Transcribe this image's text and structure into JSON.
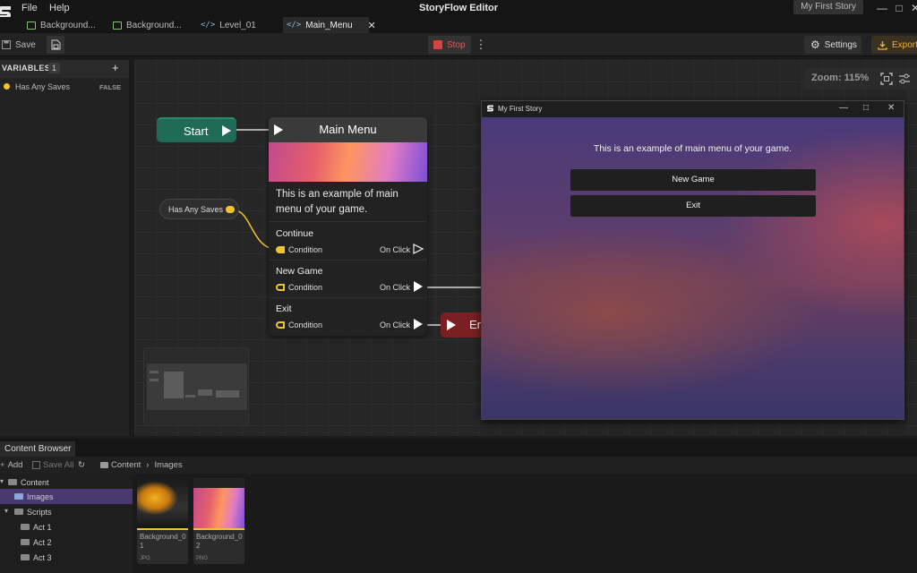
{
  "titlebar": {
    "menu": [
      "File",
      "Help"
    ],
    "app_title": "StoryFlow Editor",
    "project_name": "My First Story",
    "controls": {
      "minimize": "—",
      "maximize": "□",
      "close": "✕"
    }
  },
  "tabs": [
    {
      "label": "Background...",
      "icon": "image-icon"
    },
    {
      "label": "Background...",
      "icon": "image-icon"
    },
    {
      "label": "Level_01",
      "icon": "code-icon"
    },
    {
      "label": "Main_Menu",
      "icon": "code-icon",
      "active": true
    }
  ],
  "toolbar": {
    "save_label": "Save",
    "stop_label": "Stop",
    "settings_label": "Settings",
    "export_label": "Export"
  },
  "variables": {
    "title": "VARIABLES",
    "count": "1",
    "items": [
      {
        "name": "Has Any Saves",
        "value": "FALSE",
        "color": "#f0c430"
      }
    ]
  },
  "canvas": {
    "zoom_label": "Zoom: 115%",
    "start_node": "Start",
    "var_node": "Has Any Saves",
    "end_node": "En",
    "main_menu": {
      "title": "Main Menu",
      "text": "This is an example of main menu of your game.",
      "choices": [
        {
          "title": "Continue",
          "condition": "Condition",
          "event": "On Click"
        },
        {
          "title": "New Game",
          "condition": "Condition",
          "event": "On Click"
        },
        {
          "title": "Exit",
          "condition": "Condition",
          "event": "On Click"
        }
      ]
    }
  },
  "preview": {
    "title": "My First Story",
    "text": "This is an example of main menu of your game.",
    "buttons": [
      "New Game",
      "Exit"
    ]
  },
  "content_browser": {
    "tab_label": "Content Browser",
    "add_label": "Add",
    "save_all_label": "Save All",
    "breadcrumb": [
      "Content",
      "Images"
    ],
    "tree": [
      {
        "label": "Content"
      },
      {
        "label": "Images",
        "selected": true
      },
      {
        "label": "Scripts"
      },
      {
        "label": "Act 1"
      },
      {
        "label": "Act 2"
      },
      {
        "label": "Act 3"
      }
    ],
    "assets": [
      {
        "name": "Background_01",
        "type": "JPG"
      },
      {
        "name": "Background_02",
        "type": "PNG"
      }
    ]
  }
}
